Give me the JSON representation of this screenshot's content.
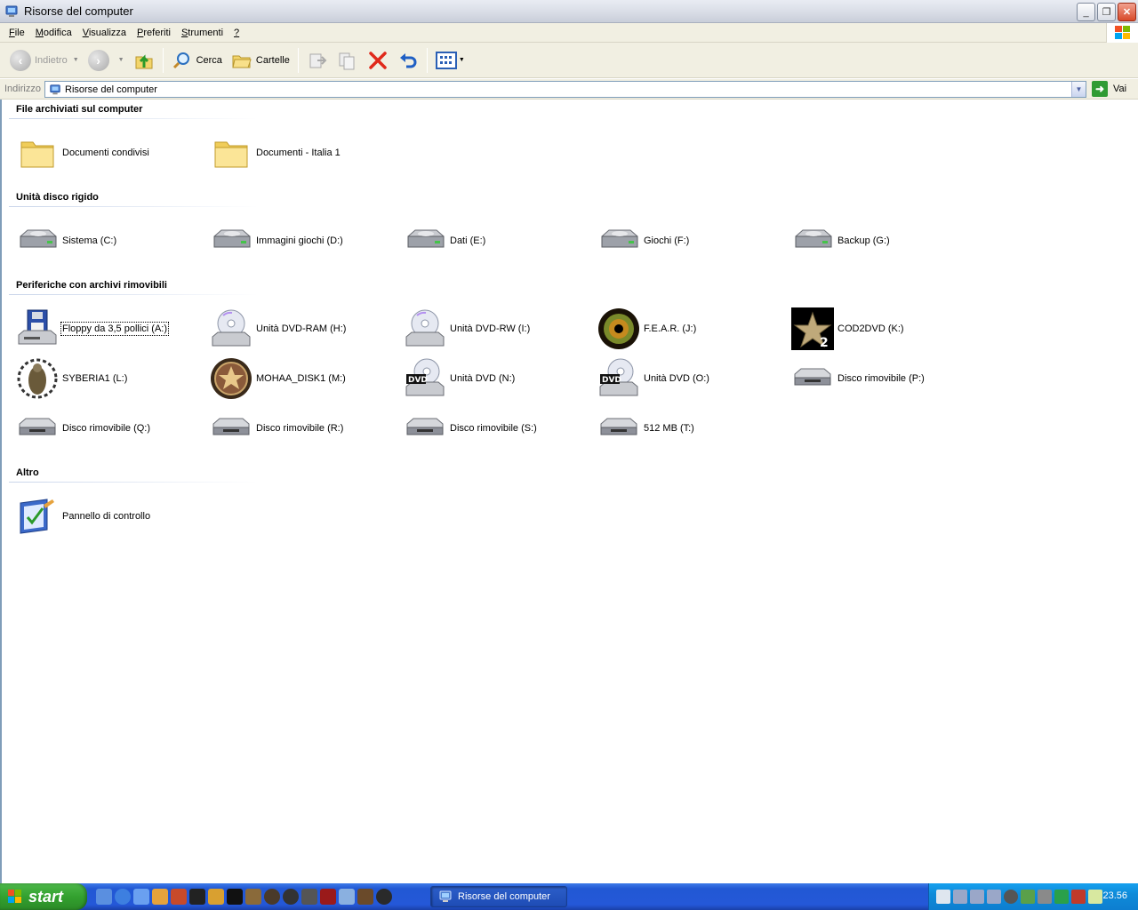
{
  "window": {
    "title": "Risorse del computer"
  },
  "menu": {
    "items": [
      {
        "underline": "F",
        "rest": "ile"
      },
      {
        "underline": "M",
        "rest": "odifica"
      },
      {
        "underline": "V",
        "rest": "isualizza"
      },
      {
        "underline": "P",
        "rest": "referiti"
      },
      {
        "underline": "S",
        "rest": "trumenti"
      },
      {
        "underline": "?",
        "rest": ""
      }
    ]
  },
  "toolbar": {
    "back_label": "Indietro",
    "search_label": "Cerca",
    "folders_label": "Cartelle"
  },
  "address": {
    "label": "Indirizzo",
    "value": "Risorse del computer",
    "go_label": "Vai"
  },
  "groups": {
    "stored_files": {
      "title": "File archiviati sul computer",
      "items": [
        "Documenti condivisi",
        "Documenti - Italia 1"
      ]
    },
    "hard_disks": {
      "title": "Unità disco rigido",
      "items": [
        "Sistema (C:)",
        "Immagini giochi (D:)",
        "Dati (E:)",
        "Giochi (F:)",
        "Backup (G:)"
      ]
    },
    "removable": {
      "title": "Periferiche con archivi rimovibili",
      "items": [
        "Floppy da 3,5 pollici (A:)",
        "Unità DVD-RAM (H:)",
        "Unità DVD-RW (I:)",
        "F.E.A.R. (J:)",
        "COD2DVD (K:)",
        "SYBERIA1 (L:)",
        "MOHAA_DISK1 (M:)",
        "Unità DVD (N:)",
        "Unità DVD (O:)",
        "Disco rimovibile (P:)",
        "Disco rimovibile (Q:)",
        "Disco rimovibile (R:)",
        "Disco rimovibile (S:)",
        "512 MB (T:)"
      ]
    },
    "other": {
      "title": "Altro",
      "items": [
        "Pannello di controllo"
      ]
    }
  },
  "taskbar": {
    "start_label": "start",
    "task_label": "Risorse del computer",
    "clock": "23.56"
  },
  "colors": {
    "taskbar": "#2458d8",
    "start": "#33a12f",
    "tray": "#0f8bd9",
    "menu_bg": "#f1efe2"
  }
}
